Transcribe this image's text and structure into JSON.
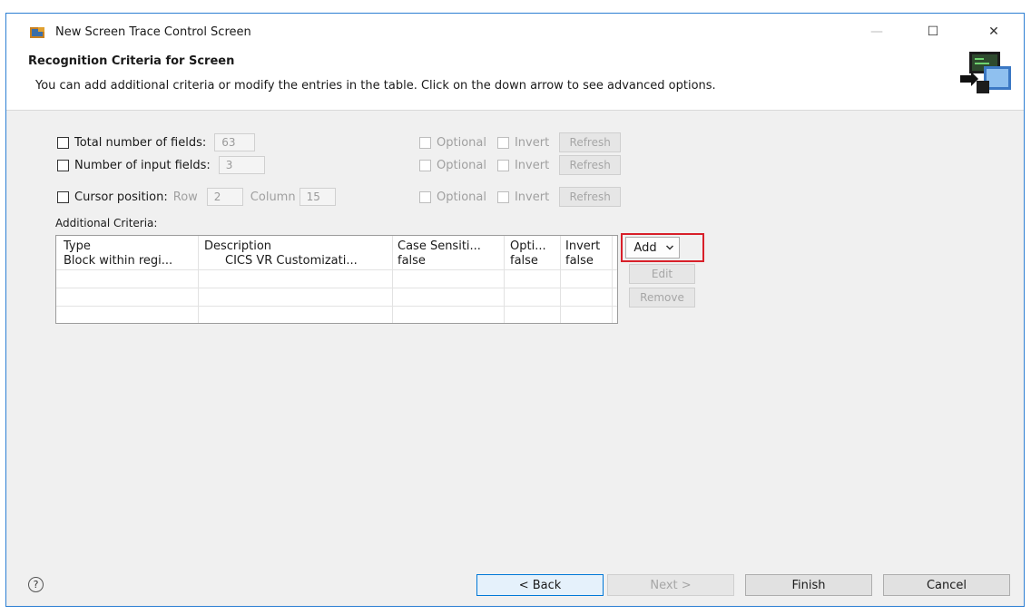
{
  "window": {
    "title": "New Screen Trace Control Screen",
    "minimize": "—",
    "maximize": "☐",
    "close": "✕"
  },
  "header": {
    "title": "Recognition Criteria for Screen",
    "description": "You can add additional criteria or modify the entries in the table. Click on the down arrow to see advanced options."
  },
  "criteria": {
    "total_fields": {
      "label": "Total number of fields:",
      "value": "63",
      "optional": "Optional",
      "invert": "Invert",
      "refresh": "Refresh"
    },
    "input_fields": {
      "label": "Number of input fields:",
      "value": "3",
      "optional": "Optional",
      "invert": "Invert",
      "refresh": "Refresh"
    },
    "cursor": {
      "label": "Cursor position:",
      "row_label": "Row",
      "row_value": "2",
      "column_label": "Column",
      "column_value": "15",
      "optional": "Optional",
      "invert": "Invert",
      "refresh": "Refresh"
    }
  },
  "additional": {
    "label": "Additional Criteria:",
    "columns": [
      "Type",
      "Description",
      "Case Sensiti...",
      "Opti...",
      "Invert"
    ],
    "rows": [
      [
        "Block within regi...",
        "CICS VR Customizati...",
        "false",
        "false",
        "false"
      ]
    ]
  },
  "side_buttons": {
    "add": "Add",
    "edit": "Edit",
    "remove": "Remove"
  },
  "footer": {
    "help": "?",
    "back": "< Back",
    "next": "Next >",
    "finish": "Finish",
    "cancel": "Cancel"
  },
  "colors": {
    "frame_border": "#2d7fd3",
    "highlight": "#d8202a",
    "focus": "#0078d7"
  }
}
